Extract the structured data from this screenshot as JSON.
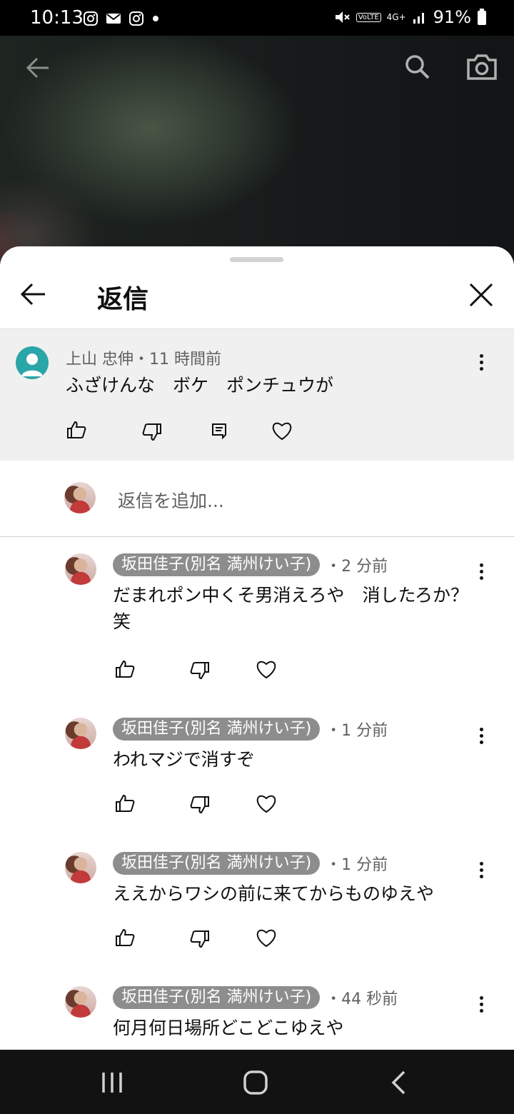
{
  "status_bar": {
    "time": "10:13",
    "battery": "91%",
    "network": "4G+",
    "volte": "VoLTE"
  },
  "video_toolbar": {
    "back_icon": "arrow-left-icon",
    "search_icon": "search-icon",
    "camera_icon": "camera-icon"
  },
  "sheet": {
    "title": "返信",
    "back_icon": "arrow-left-icon",
    "close_icon": "close-icon"
  },
  "original_comment": {
    "author": "上山 忠伸",
    "time": "・11 時間前",
    "text": "ふざけんな　ボケ　ポンチュウが"
  },
  "reply_input": {
    "placeholder": "返信を追加..."
  },
  "replies": [
    {
      "author": "坂田佳子(別名 満州けい子)",
      "time": "・2 分前",
      "text": "だまれポン中くそ男消えろや　消したろか？笑"
    },
    {
      "author": "坂田佳子(別名 満州けい子)",
      "time": "・1 分前",
      "text": "われマジで消すぞ"
    },
    {
      "author": "坂田佳子(別名 満州けい子)",
      "time": "・1 分前",
      "text": "ええからワシの前に来てからものゆえや"
    },
    {
      "author": "坂田佳子(別名 満州けい子)",
      "time": "・44 秒前",
      "text": "何月何日場所どこどこゆえや"
    }
  ],
  "colors": {
    "sheet_bg": "#ffffff",
    "highlight_bg": "#f0f0f0",
    "chip_bg": "#8d8d8d",
    "avatar_teal": "#2aa5a8"
  }
}
